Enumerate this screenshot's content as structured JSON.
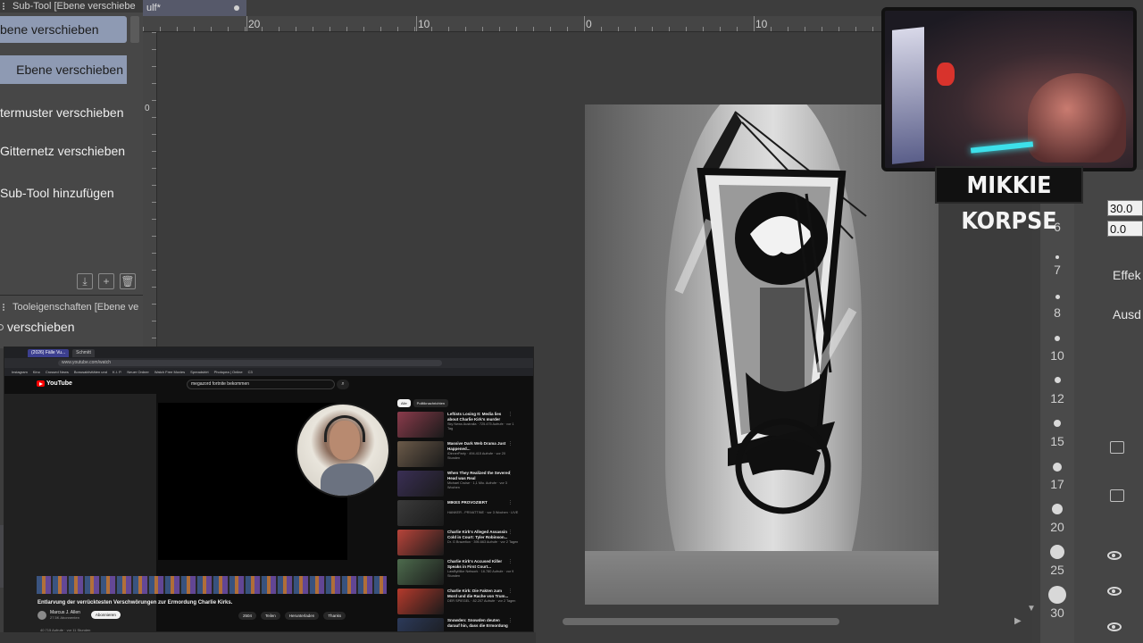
{
  "subtool_panel": {
    "title": "Sub-Tool [Ebene verschiebe",
    "items": [
      {
        "label": "bene verschieben",
        "selected": true
      },
      {
        "label": "Ebene verschieben",
        "selected": true
      },
      {
        "label": "termuster verschieben",
        "selected": false
      },
      {
        "label": "Gitternetz verschieben",
        "selected": false
      },
      {
        "label": "Sub-Tool hinzufügen",
        "selected": false
      }
    ],
    "icons": [
      "export-icon",
      "add-icon",
      "trash-icon"
    ]
  },
  "tool_properties": {
    "title": "Tooleigenschaften [Ebene ve",
    "tool_name": "verschieben"
  },
  "document": {
    "tab_label": "ulf*",
    "ruler_top": [
      "20",
      "10",
      "0",
      "10"
    ],
    "ruler_left": [
      "0"
    ]
  },
  "brush_sizes": [
    "6",
    "7",
    "8",
    "10",
    "12",
    "15",
    "17",
    "20",
    "25",
    "30"
  ],
  "right_panel": {
    "value_1": "30.0",
    "value_2": "0.0",
    "label_effect": "Effek",
    "label_ausd": "Ausd"
  },
  "stream": {
    "streamer_name": "MIKKIE KORPSE"
  },
  "youtube": {
    "tabs": [
      "(2026) Fälle Vu...",
      "Schmitt"
    ],
    "url": "www.youtube.com/watch",
    "bookmarks": [
      "Instagram",
      "Kino",
      "Crossed News",
      "Bonusaktivitäten und",
      "K.I. P.",
      "Neuer Ordner",
      "Watch Free Movies",
      "Spreadshirt",
      "Photopea | Online",
      "C3"
    ],
    "logo_text": "YouTube",
    "search_query": "megazord fortnite bekommen",
    "video_title": "Entlarvung der verrücktesten Verschwörungen zur Ermordung Charlie Kirks.",
    "channel_name": "Marcus J. Allen",
    "channel_subs": "27.5K Abonnenten",
    "subscribe_label": "Abonnieren",
    "actions": [
      "2504",
      "Teilen",
      "Herunterladen",
      "Thanks"
    ],
    "stats": "40.715 Aufrufe · vor 11 Stunden",
    "chips": [
      "Alle",
      "Politiknachrichten"
    ],
    "recommendations": [
      {
        "title": "Leftists Losing It: Media lies about Charlie Kirk's murder",
        "meta": "Sky News Australia · 725.475 Aufrufe · vor 1 Tag",
        "thumb": "#8a3b4b"
      },
      {
        "title": "Massive Dark Web Drama Just Happened...",
        "meta": "iDinnerParty · 494.415 Aufrufe · vor 20 Stunden",
        "thumb": "#6b5a49"
      },
      {
        "title": "When They Realized the Severed Head was Real",
        "meta": "Michael Cruise · 1,1 Mio. Aufrufe · vor 3 Wochen",
        "thumb": "#3a2f55"
      },
      {
        "title": "MIKES PROVOZIERT",
        "meta": "HANKER - PRIVATTINE · vor 3 Wochen · LIVE",
        "thumb": "#3b3b3b"
      },
      {
        "title": "Charlie Kirk's Alleged Assassin Cold in Court: Tyler Robinson...",
        "meta": "Dr. G Brazelton · 395.663 Aufrufe · vor 2 Tagen",
        "thumb": "#b8443a"
      },
      {
        "title": "Charlie Kirk's Accused Killer Speaks in First Court...",
        "meta": "LawByMike Network · 16.780 Aufrufe · vor 9 Stunden",
        "thumb": "#4d6b4d"
      },
      {
        "title": "Charlie Kirk: Die Fakten zum Mord und die Rache von Trum...",
        "meta": "DER SPIEGEL · 82.207 Aufrufe · vor 2 Tagen",
        "thumb": "#b53a2c"
      },
      {
        "title": "Snowden: Snowden deuten darauf hin, dass die Ermordung von...",
        "meta": "",
        "thumb": "#2c3a5a"
      }
    ]
  }
}
